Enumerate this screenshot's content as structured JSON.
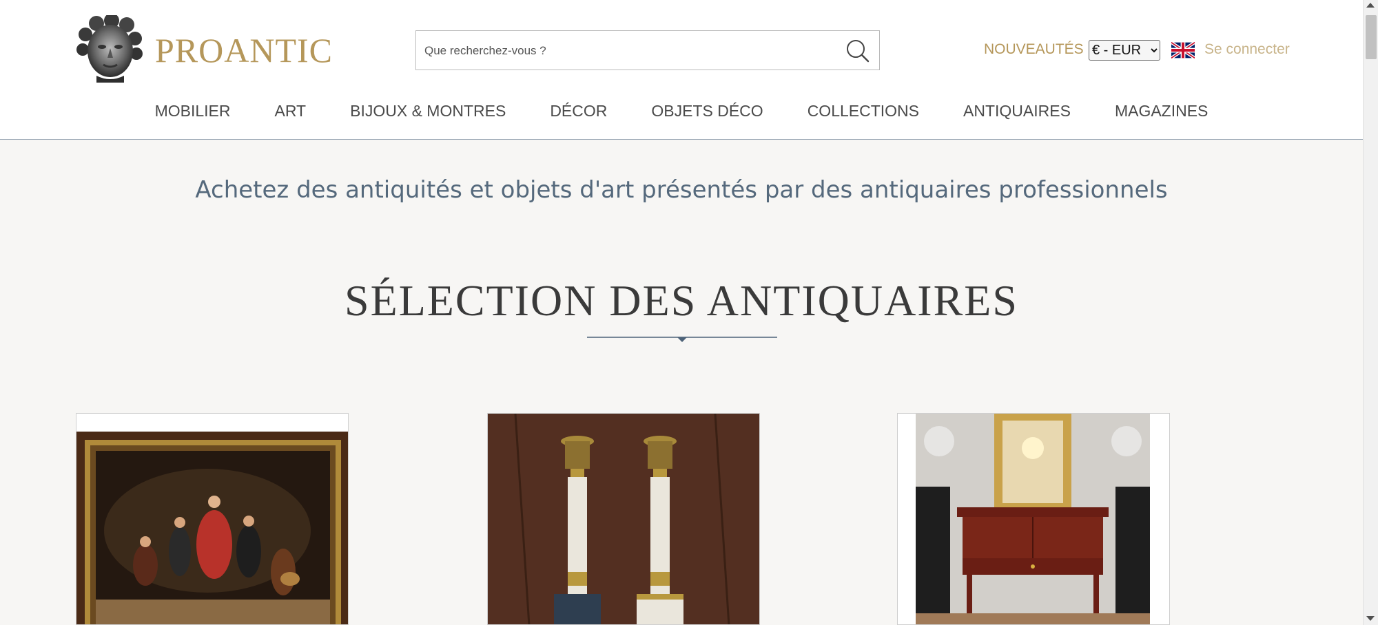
{
  "brand": {
    "name": "PROANTIC",
    "logo_icon": "bust-head-icon"
  },
  "search": {
    "placeholder": "Que recherchez-vous ?",
    "value": "",
    "icon": "search-icon"
  },
  "header": {
    "news_label": "NOUVEAUTÉS",
    "currency": {
      "selected": "€ - EUR",
      "options": [
        "€ - EUR"
      ]
    },
    "language_icon": "uk-flag-icon",
    "login_label": "Se connecter"
  },
  "nav": {
    "items": [
      {
        "label": "MOBILIER"
      },
      {
        "label": "ART"
      },
      {
        "label": "BIJOUX & MONTRES"
      },
      {
        "label": "DÉCOR"
      },
      {
        "label": "OBJETS DÉCO"
      },
      {
        "label": "COLLECTIONS"
      },
      {
        "label": "ANTIQUAIRES"
      },
      {
        "label": "MAGAZINES"
      }
    ]
  },
  "main": {
    "tagline": "Achetez des antiquités et objets d'art présentés par des antiquaires professionnels",
    "section_title": "SÉLECTION DES ANTIQUAIRES"
  },
  "colors": {
    "gold": "#b5975a",
    "login_gold": "#c8b48a",
    "nav_text": "#4a4a4a",
    "tagline": "#55697c",
    "divider": "#4d6278",
    "background": "#f7f6f4"
  }
}
